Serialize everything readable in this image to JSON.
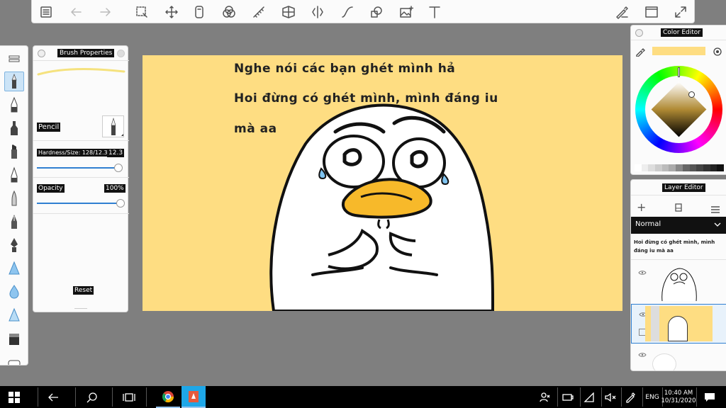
{
  "brush_properties": {
    "title": "Brush Properties",
    "brush_name": "Pencil",
    "hardness_size_label": "Hardness/Size: 128/12.3",
    "size_value": "12.3",
    "opacity_label": "Opacity",
    "opacity_value": "100%",
    "reset_label": "Reset"
  },
  "canvas": {
    "line1": "Nghe nói các bạn ghét mình hả",
    "line2": "Hoi đừng có ghét mình, mình đáng iu",
    "line3": "mà aa"
  },
  "color_editor": {
    "title": "Color Editor",
    "current_color": "#fedd82",
    "swatches": [
      "#ffffff",
      "#eeeeee",
      "#dddddd",
      "#cccccc",
      "#bbbbbb",
      "#aaaaaa",
      "#888888",
      "#666666",
      "#555555",
      "#444444",
      "#333333",
      "#222222",
      "#111111"
    ]
  },
  "layer_editor": {
    "title": "Layer Editor",
    "blend_mode": "Normal",
    "text_layer_preview": "Hoi đừng có ghét mình, mình đáng iu mà aa"
  },
  "taskbar": {
    "language": "ENG",
    "time": "10:40 AM",
    "date": "10/31/2020"
  },
  "colors": {
    "canvas_bg": "#fedd82",
    "accent": "#2f7fd1",
    "duck_beak": "#f7b92a"
  }
}
